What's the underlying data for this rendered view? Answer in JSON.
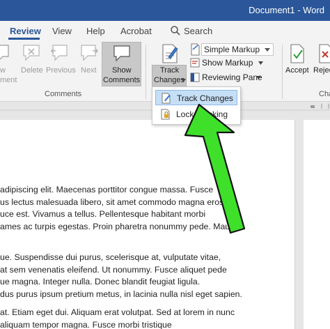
{
  "titlebar": {
    "title": "Document1 - Word"
  },
  "tabs": [
    {
      "label": "Review",
      "active": true
    },
    {
      "label": "View"
    },
    {
      "label": "Help"
    },
    {
      "label": "Acrobat"
    }
  ],
  "search": {
    "label": "Search"
  },
  "ribbon": {
    "comments_group": {
      "label": "Comments",
      "new_comment_partial": [
        "w",
        "ment"
      ],
      "delete": "Delete",
      "previous": "Previous",
      "next": "Next",
      "show_comments": [
        "Show",
        "Comments"
      ]
    },
    "tracking_group": {
      "track_changes": [
        "Track",
        "Changes"
      ],
      "markup_select": "Simple Markup",
      "show_markup": "Show Markup",
      "reviewing_pane": "Reviewing Pane"
    },
    "changes_group": {
      "accept": "Accept",
      "reject_partial": "Rejec",
      "label_partial": "Cha"
    }
  },
  "track_menu": {
    "items": [
      {
        "label": "Track Changes",
        "hovered": true
      },
      {
        "label": "Lock Tracking"
      }
    ]
  },
  "document": {
    "paragraphs": [
      [
        "adipiscing elit. Maecenas porttitor congue massa. Fusce",
        "us lectus malesuada libero, sit amet commodo magna eros",
        "uce est. Vivamus a tellus. Pellentesque habitant morbi",
        "ames ac turpis egestas. Proin pharetra nonummy pede. Mauris"
      ],
      [
        "ue. Suspendisse dui purus, scelerisque at, vulputate vitae,",
        "at sem venenatis eleifend. Ut nonummy. Fusce aliquet pede",
        "ue magna. Integer nulla. Donec blandit feugiat ligula.",
        "dus purus ipsum pretium metus, in lacinia nulla nisl eget sapien."
      ],
      [
        "at. Etiam eget dui. Aliquam erat volutpat. Sed at lorem in nunc",
        "aliquam tempor magna. Fusce morbi tristique"
      ]
    ]
  },
  "colors": {
    "accent": "#2b579a",
    "arrow": "#3ee02a",
    "menu_hover": "#c5dff6"
  }
}
